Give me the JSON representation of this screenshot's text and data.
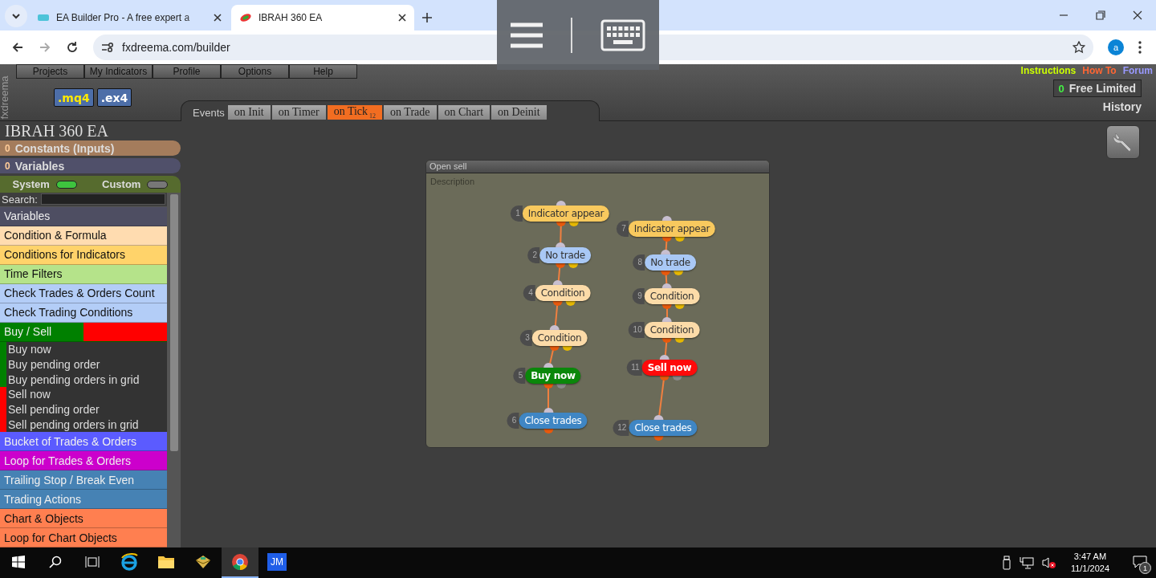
{
  "browser": {
    "tabs": [
      {
        "title": "EA Builder Pro - A free expert a",
        "selected": false
      },
      {
        "title": "IBRAH 360 EA",
        "selected": true
      }
    ],
    "url": "fxdreema.com/builder",
    "avatar": "a"
  },
  "app": {
    "logo": "fxdreema",
    "menu": [
      "Projects",
      "My Indicators",
      "Profile",
      "Options",
      "Help"
    ],
    "exports": [
      ".mq4",
      ".ex4"
    ],
    "events_label": "Events",
    "event_tabs": [
      {
        "label": "on Init",
        "selected": false
      },
      {
        "label": "on Timer",
        "selected": false
      },
      {
        "label": "on Tick",
        "badge": "12",
        "selected": true
      },
      {
        "label": "on Trade",
        "selected": false
      },
      {
        "label": "on Chart",
        "selected": false
      },
      {
        "label": "on Deinit",
        "selected": false
      }
    ],
    "links": [
      {
        "label": "Instructions",
        "color": "#ccff00"
      },
      {
        "label": "How To",
        "color": "#ff6633"
      },
      {
        "label": "Forum",
        "color": "#9999ff"
      }
    ],
    "credits": "0",
    "plan": "Free Limited",
    "history": "History"
  },
  "sidebar": {
    "title": "IBRAH 360 EA",
    "sections": [
      {
        "count": "0",
        "label": "Constants (Inputs)",
        "color": "#a47c5c"
      },
      {
        "count": "0",
        "label": "Variables",
        "color": "#50506a"
      }
    ],
    "toggles": [
      {
        "label": "System",
        "on": true
      },
      {
        "label": "Custom",
        "on": false
      }
    ],
    "search_label": "Search:",
    "items": [
      {
        "label": "Variables",
        "color": "#4e4e62"
      },
      {
        "label": "Condition & Formula",
        "color": "#ffdcb0"
      },
      {
        "label": "Conditions for Indicators",
        "color": "#ffd36a"
      },
      {
        "label": "Time Filters",
        "color": "#b5e38a"
      },
      {
        "label": "Check Trades & Orders Count",
        "color": "#b3cdf7"
      },
      {
        "label": "Check Trading Conditions",
        "color": "#b3cdf7"
      },
      {
        "label": "Buy / Sell",
        "color": "#008000",
        "expanded": true,
        "children": [
          {
            "label": "Buy now",
            "color": "#008000"
          },
          {
            "label": "Buy pending order",
            "color": "#008000"
          },
          {
            "label": "Buy pending orders in grid",
            "color": "#008000"
          },
          {
            "label": "Sell now",
            "color": "#ff0000"
          },
          {
            "label": "Sell pending order",
            "color": "#ff0000"
          },
          {
            "label": "Sell pending orders in grid",
            "color": "#ff0000"
          }
        ]
      },
      {
        "label": "Bucket of Trades & Orders",
        "color": "#5b5bff"
      },
      {
        "label": "Loop for Trades & Orders",
        "color": "#cc00cc"
      },
      {
        "label": "Trailing Stop / Break Even",
        "color": "#4682b4"
      },
      {
        "label": "Trading Actions",
        "color": "#4682b4"
      },
      {
        "label": "Chart & Objects",
        "color": "#ff7f50"
      },
      {
        "label": "Loop for Chart Objects",
        "color": "#ff7f50"
      }
    ]
  },
  "panel": {
    "title": "Open sell",
    "description": "Description",
    "flows": [
      {
        "nodes": [
          {
            "number": "1",
            "label": "Indicator appear",
            "kind": "indicator"
          },
          {
            "number": "2",
            "label": "No trade",
            "kind": "notrade"
          },
          {
            "number": "4",
            "label": "Condition",
            "kind": "condition"
          },
          {
            "number": "3",
            "label": "Condition",
            "kind": "condition"
          },
          {
            "number": "5",
            "label": "Buy now",
            "kind": "buy"
          },
          {
            "number": "6",
            "label": "Close trades",
            "kind": "close"
          }
        ]
      },
      {
        "nodes": [
          {
            "number": "7",
            "label": "Indicator appear",
            "kind": "indicator"
          },
          {
            "number": "8",
            "label": "No trade",
            "kind": "notrade"
          },
          {
            "number": "9",
            "label": "Condition",
            "kind": "condition"
          },
          {
            "number": "10",
            "label": "Condition",
            "kind": "condition"
          },
          {
            "number": "11",
            "label": "Sell now",
            "kind": "sell"
          },
          {
            "number": "12",
            "label": "Close trades",
            "kind": "close"
          }
        ]
      }
    ]
  },
  "taskbar": {
    "time": "3:47 AM",
    "date": "11/1/2024",
    "notifications": "1",
    "apps": [
      {
        "kind": "ie",
        "selected": false
      },
      {
        "kind": "folder",
        "selected": false
      },
      {
        "kind": "box",
        "selected": false
      },
      {
        "kind": "chrome",
        "selected": true
      },
      {
        "kind": "text",
        "label": "JM",
        "selected": false
      }
    ]
  }
}
